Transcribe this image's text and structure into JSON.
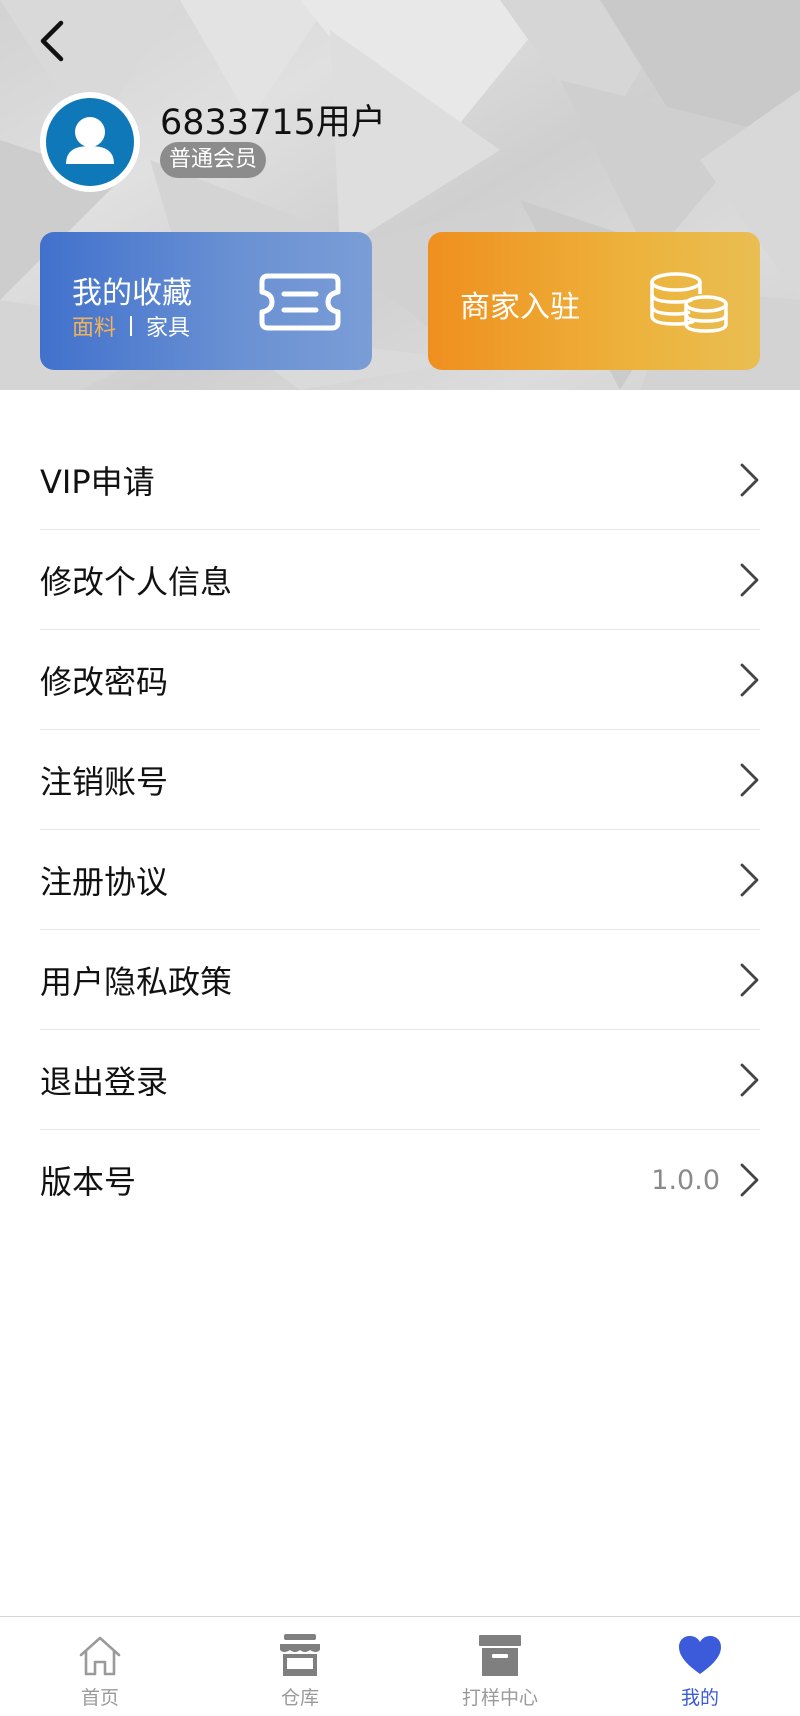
{
  "header": {
    "username": "6833715用户",
    "member_level": "普通会员"
  },
  "cards": {
    "favorites": {
      "title": "我的收藏",
      "sub_left": "面料",
      "sub_right": "家具",
      "icon": "ticket-icon"
    },
    "merchant": {
      "title": "商家入驻",
      "icon": "coins-icon"
    }
  },
  "menu": {
    "items": [
      {
        "label": "VIP申请"
      },
      {
        "label": "修改个人信息"
      },
      {
        "label": "修改密码"
      },
      {
        "label": "注销账号"
      },
      {
        "label": "注册协议"
      },
      {
        "label": "用户隐私政策"
      },
      {
        "label": "退出登录"
      },
      {
        "label": "版本号",
        "value": "1.0.0"
      }
    ]
  },
  "tabbar": {
    "items": [
      {
        "label": "首页",
        "icon": "home-icon"
      },
      {
        "label": "仓库",
        "icon": "store-icon"
      },
      {
        "label": "打样中心",
        "icon": "archive-box-icon"
      },
      {
        "label": "我的",
        "icon": "heart-icon",
        "active": true
      }
    ]
  },
  "colors": {
    "accent": "#3b5bdb",
    "avatar": "#0f78b9",
    "favorites_card": "#4171cc",
    "merchant_card": "#ef8f1f",
    "fabric_highlight": "#f1b25a"
  }
}
